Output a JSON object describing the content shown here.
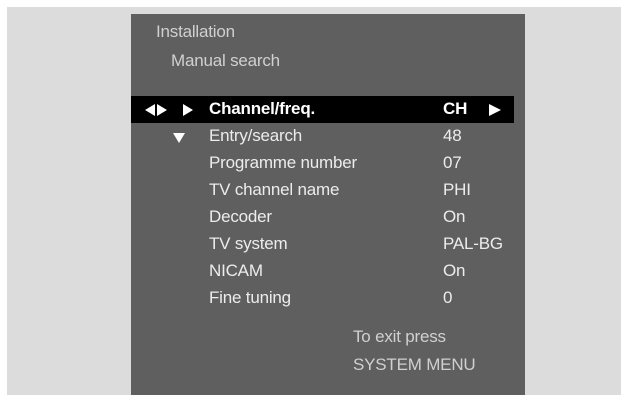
{
  "menu": {
    "title": "Installation",
    "subtitle": "Manual search",
    "items": [
      {
        "label": "Channel/freq.",
        "value": "CH"
      },
      {
        "label": "Entry/search",
        "value": "48"
      },
      {
        "label": "Programme number",
        "value": "07"
      },
      {
        "label": "TV channel name",
        "value": "PHI"
      },
      {
        "label": "Decoder",
        "value": "On"
      },
      {
        "label": "TV system",
        "value": "PAL-BG"
      },
      {
        "label": "NICAM",
        "value": "On"
      },
      {
        "label": "Fine tuning",
        "value": "0"
      }
    ],
    "selected_index": 0
  },
  "footer": {
    "line1": "To exit press",
    "line2": "SYSTEM MENU"
  },
  "icons": {
    "nav": "left-right-right-arrows-icon",
    "value": "right-arrow-icon",
    "more": "down-arrow-icon"
  },
  "colors": {
    "frame": "#dcdcdc",
    "panel": "#5f5f5f",
    "highlight": "#000000",
    "text": "#ececec"
  }
}
